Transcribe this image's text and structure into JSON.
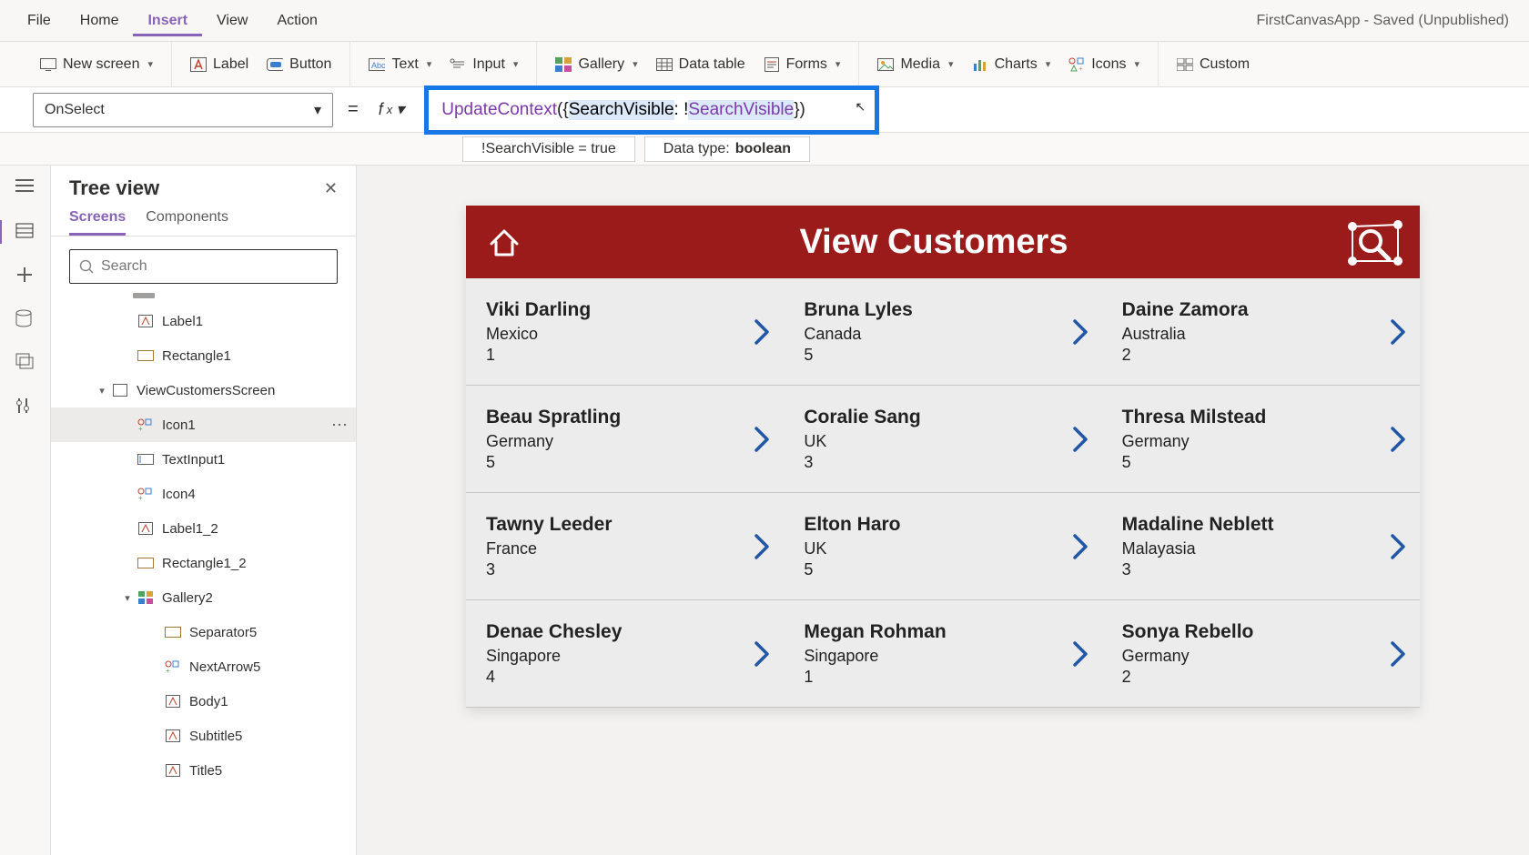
{
  "app_title": "FirstCanvasApp - Saved (Unpublished)",
  "menu": {
    "file": "File",
    "home": "Home",
    "insert": "Insert",
    "view": "View",
    "action": "Action"
  },
  "ribbon": {
    "new_screen": "New screen",
    "label": "Label",
    "button": "Button",
    "text": "Text",
    "input": "Input",
    "gallery": "Gallery",
    "datatable": "Data table",
    "forms": "Forms",
    "media": "Media",
    "charts": "Charts",
    "icons": "Icons",
    "custom": "Custom"
  },
  "property": "OnSelect",
  "formula": {
    "fn": "UpdateContext",
    "open": "({",
    "var1": "SearchVisible",
    "colon": ": !",
    "var2": "SearchVisible",
    "close": "})"
  },
  "hint": {
    "expr": "!SearchVisible  =  true",
    "label": "Data type: ",
    "type": "boolean"
  },
  "tree": {
    "title": "Tree view",
    "tabs": {
      "screens": "Screens",
      "components": "Components"
    },
    "search_placeholder": "Search",
    "nodes": {
      "label1": "Label1",
      "rectangle1": "Rectangle1",
      "viewcust": "ViewCustomersScreen",
      "icon1": "Icon1",
      "textinput1": "TextInput1",
      "icon4": "Icon4",
      "label1_2": "Label1_2",
      "rectangle1_2": "Rectangle1_2",
      "gallery2": "Gallery2",
      "separator5": "Separator5",
      "nextarrow5": "NextArrow5",
      "body1": "Body1",
      "subtitle5": "Subtitle5",
      "title5": "Title5"
    }
  },
  "preview": {
    "title": "View Customers",
    "cards": [
      {
        "name": "Viki  Darling",
        "country": "Mexico",
        "num": "1"
      },
      {
        "name": "Bruna  Lyles",
        "country": "Canada",
        "num": "5"
      },
      {
        "name": "Daine  Zamora",
        "country": "Australia",
        "num": "2"
      },
      {
        "name": "Beau  Spratling",
        "country": "Germany",
        "num": "5"
      },
      {
        "name": "Coralie  Sang",
        "country": "UK",
        "num": "3"
      },
      {
        "name": "Thresa  Milstead",
        "country": "Germany",
        "num": "5"
      },
      {
        "name": "Tawny  Leeder",
        "country": "France",
        "num": "3"
      },
      {
        "name": "Elton  Haro",
        "country": "UK",
        "num": "5"
      },
      {
        "name": "Madaline  Neblett",
        "country": "Malayasia",
        "num": "3"
      },
      {
        "name": "Denae  Chesley",
        "country": "Singapore",
        "num": "4"
      },
      {
        "name": "Megan  Rohman",
        "country": "Singapore",
        "num": "1"
      },
      {
        "name": "Sonya  Rebello",
        "country": "Germany",
        "num": "2"
      }
    ]
  }
}
